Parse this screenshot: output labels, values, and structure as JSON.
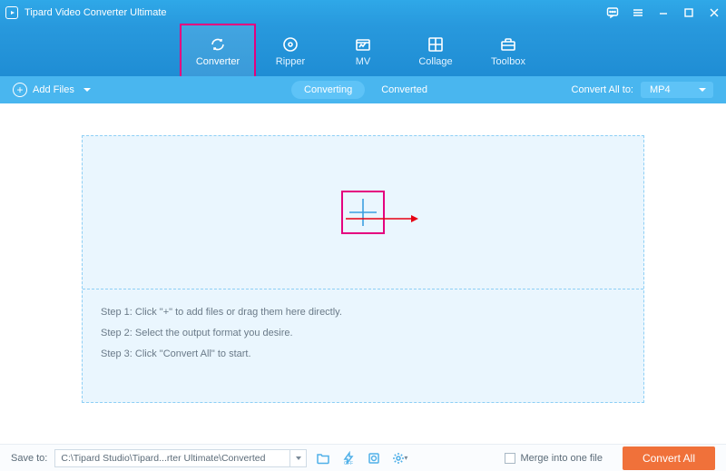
{
  "titlebar": {
    "title": "Tipard Video Converter Ultimate"
  },
  "nav": {
    "items": [
      {
        "label": "Converter"
      },
      {
        "label": "Ripper"
      },
      {
        "label": "MV"
      },
      {
        "label": "Collage"
      },
      {
        "label": "Toolbox"
      }
    ]
  },
  "toolbar": {
    "add_files": "Add Files",
    "tab_converting": "Converting",
    "tab_converted": "Converted",
    "convert_all_to": "Convert All to:",
    "format": "MP4"
  },
  "steps": {
    "s1": "Step 1: Click \"+\" to add files or drag them here directly.",
    "s2": "Step 2: Select the output format you desire.",
    "s3": "Step 3: Click \"Convert All\" to start."
  },
  "bottom": {
    "save_to_label": "Save to:",
    "path": "C:\\Tipard Studio\\Tipard...rter Ultimate\\Converted",
    "merge_label": "Merge into one file",
    "convert_btn": "Convert All"
  }
}
